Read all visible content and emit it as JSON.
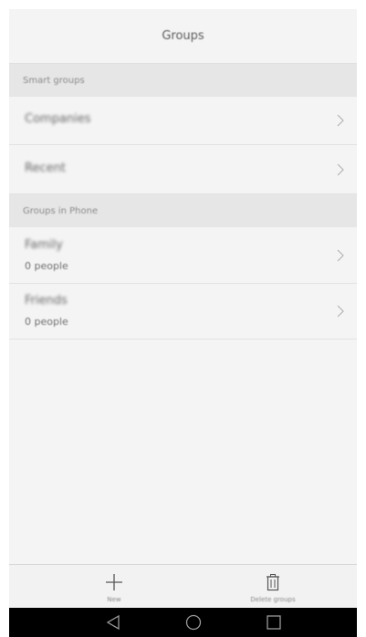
{
  "header": {
    "title": "Groups"
  },
  "sections": [
    {
      "title": "Smart groups",
      "items": [
        {
          "label": "Companies"
        },
        {
          "label": "Recent"
        }
      ]
    },
    {
      "title": "Groups in Phone",
      "items": [
        {
          "label": "Family",
          "subtitle": "0 people"
        },
        {
          "label": "Friends",
          "subtitle": "0 people"
        }
      ]
    }
  ],
  "bottom_bar": {
    "new_label": "New",
    "delete_label": "Delete groups"
  },
  "icons": {
    "chevron": "chevron-right-icon",
    "new": "plus-icon",
    "delete": "trash-icon",
    "back": "back-triangle-icon",
    "home": "home-circle-icon",
    "recents": "recents-square-icon"
  }
}
